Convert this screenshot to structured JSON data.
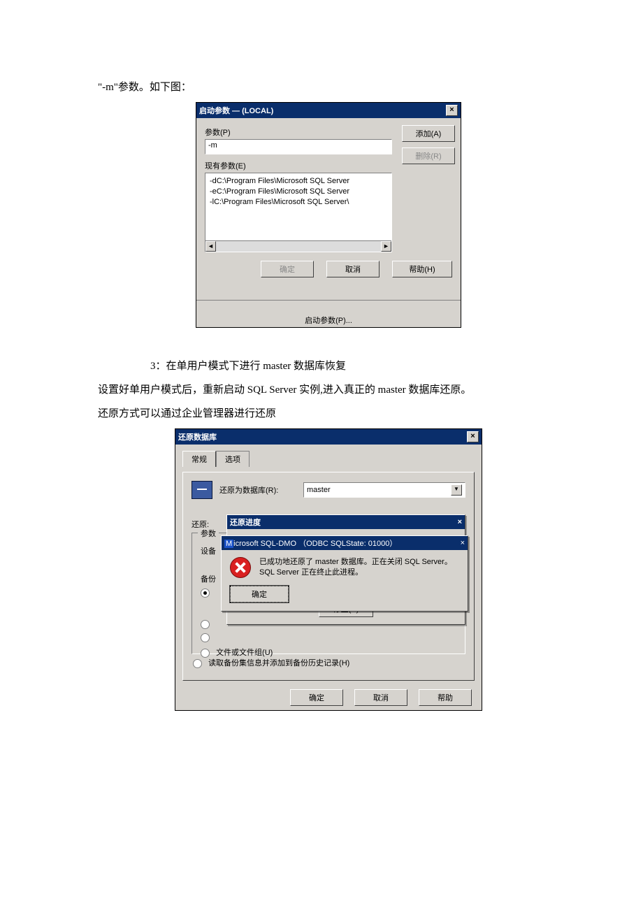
{
  "doc": {
    "line1": "\"-m\"参数。如下图：",
    "step3": "3：在单用户模式下进行 master 数据库恢复",
    "para2": "设置好单用户模式后，重新启动 SQL Server 实例,进入真正的 master 数据库还原。",
    "para3": "还原方式可以通过企业管理器进行还原"
  },
  "dlg1": {
    "title": "启动参数 — (LOCAL)",
    "param_label": "参数(P)",
    "param_accel": "P",
    "param_value": "-m",
    "existing_label": "现有参数(E)",
    "existing_accel": "E",
    "items": [
      "-dC:\\Program Files\\Microsoft SQL Server",
      "-eC:\\Program Files\\Microsoft SQL Server",
      "-lC:\\Program Files\\Microsoft SQL Server\\"
    ],
    "add": "添加(A)",
    "add_accel": "A",
    "remove": "删除(R)",
    "remove_accel": "R",
    "ok": "确定",
    "cancel": "取消",
    "help": "帮助(H)",
    "help_accel": "H",
    "bottom_link": "启动参数(P)..."
  },
  "dlg2": {
    "title": "还原数据库",
    "tab_general": "常规",
    "tab_options": "选项",
    "restore_as_label": "还原为数据库(R):",
    "restore_as_value": "master",
    "restore_label": "还原:",
    "progress_title": "还原进度",
    "params_legend": "参数",
    "device_label": "设备",
    "backup_label": "备份",
    "ellipsis": "...",
    "msg_title_prefix": "M",
    "msg_title_rest": "icrosoft SQL-DMO （ODBC SQLState: 01000）",
    "msg_text": "已成功地还原了 master 数据库。正在关闭 SQL Server。SQL Server 正在终止此进程。",
    "msg_ok": "确定",
    "stop": "停止(S)",
    "opt_filegroup": "文件或文件组(U)",
    "opt_readbackupset": "读取备份集信息并添加到备份历史记录(H)",
    "ok": "确定",
    "cancel": "取消",
    "help": "帮助"
  }
}
